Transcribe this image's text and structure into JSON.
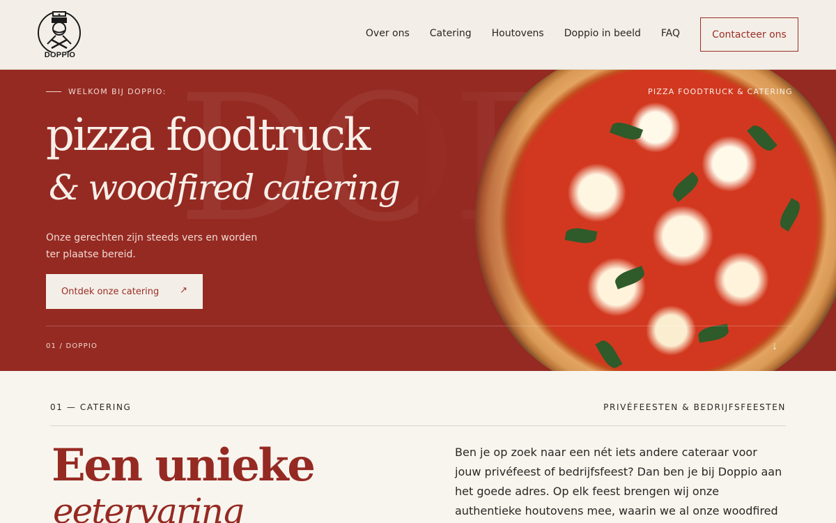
{
  "header": {
    "logo_text": "DOPPIO",
    "nav": [
      "Over ons",
      "Catering",
      "Houtovens",
      "Doppio in beeld",
      "FAQ"
    ],
    "contact_label": "Contacteer ons"
  },
  "hero": {
    "eyebrow": "WELKOM BIJ DOPPIO:",
    "watermark": "DOPP",
    "title_line1": "pizza foodtruck",
    "title_line2": "& woodfired catering",
    "description": "Onze gerechten zijn steeds vers en worden ter plaatse bereid.",
    "cta_label": "Ontdek onze catering",
    "cta_icon": "↗",
    "index_label": "01 / DOPPIO",
    "right_label": "PIZZA FOODTRUCK & CATERING",
    "scroll_icon": "↓"
  },
  "catering": {
    "label": "01 — CATERING",
    "right_label": "PRIVÉFEESTEN & BEDRIJFSFEESTEN",
    "title_line1": "Een unieke",
    "title_line2": "eetervaring",
    "body": "Ben je op zoek naar een nét iets andere cateraar voor jouw privéfeest of bedrijfsfeest? Dan ben je bij Doppio aan het goede adres. Op elk feest brengen wij onze authentieke houtovens mee, waarin we al onze woodfired gerechten"
  },
  "colors": {
    "brand_red": "#952a22",
    "cream": "#f3efe8",
    "text": "#2a2522"
  }
}
